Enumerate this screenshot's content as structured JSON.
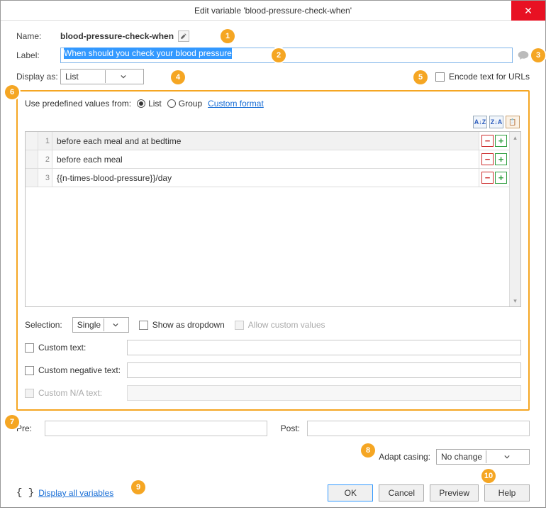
{
  "title": "Edit variable 'blood-pressure-check-when'",
  "fields": {
    "name_label": "Name:",
    "name_value": "blood-pressure-check-when",
    "label_label": "Label:",
    "label_value": "When should you check your blood pressure",
    "display_label": "Display as:",
    "display_value": "List",
    "encode_label": "Encode text for URLs"
  },
  "predef": {
    "heading": "Use predefined values from:",
    "radio_list": "List",
    "radio_group": "Group",
    "custom_format": "Custom format",
    "sort_az": "A↓Z",
    "sort_za": "Z↓A"
  },
  "rows": [
    {
      "n": "1",
      "text": "before each meal and at bedtime"
    },
    {
      "n": "2",
      "text": "before each meal"
    },
    {
      "n": "3",
      "text": "{{n-times-blood-pressure}}/day"
    }
  ],
  "selection": {
    "label": "Selection:",
    "value": "Single",
    "show_dropdown": "Show as dropdown",
    "allow_custom": "Allow custom values"
  },
  "custom": {
    "text_label": "Custom text:",
    "neg_label": "Custom negative text:",
    "na_label": "Custom N/A text:"
  },
  "prepost": {
    "pre": "Pre:",
    "post": "Post:"
  },
  "adapt": {
    "label": "Adapt casing:",
    "value": "No change"
  },
  "bottom": {
    "display_all": "Display all variables"
  },
  "buttons": {
    "ok": "OK",
    "cancel": "Cancel",
    "preview": "Preview",
    "help": "Help"
  },
  "callouts": [
    "1",
    "2",
    "3",
    "4",
    "5",
    "6",
    "7",
    "8",
    "9",
    "10"
  ]
}
